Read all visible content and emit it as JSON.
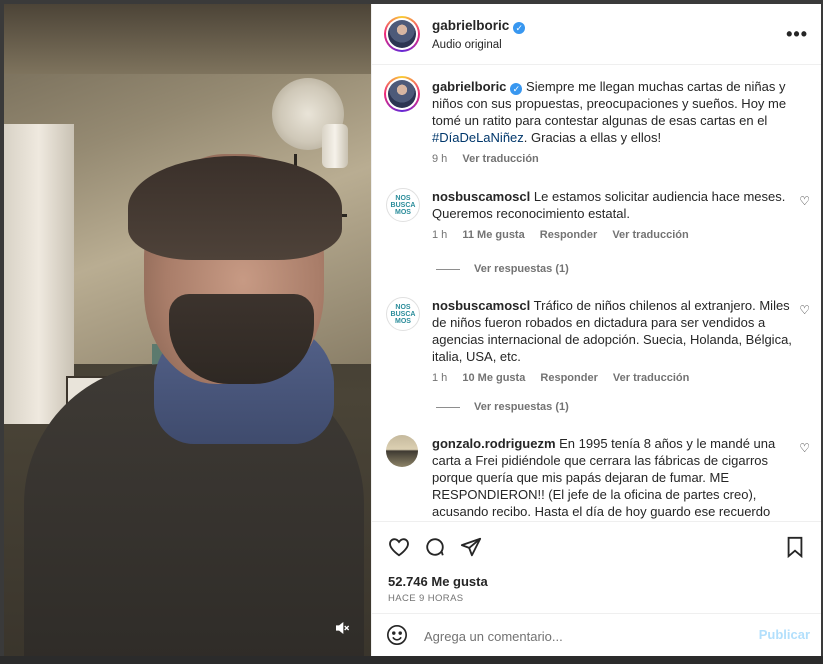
{
  "post": {
    "author": "gabrielboric",
    "audio": "Audio original",
    "caption_prefix": "Siempre me llegan muchas cartas de niñas y niños con sus propuestas, preocupaciones y sueños. Hoy me tomé un ratito para contestar algunas de esas cartas en el ",
    "caption_hashtag": "#DíaDeLaNiñez",
    "caption_suffix": ". Gracias a ellas y ellos!",
    "caption_time": "9 h",
    "caption_translate": "Ver traducción",
    "likes": "52.746 Me gusta",
    "posted": "HACE 9 HORAS"
  },
  "comments": [
    {
      "user": "nosbuscamoscl",
      "avatar_text": "NOS BUSCA MOS",
      "text": "Le estamos solicitar audiencia hace meses. Queremos reconocimiento estatal.",
      "time": "1 h",
      "likes": "11 Me gusta",
      "reply": "Responder",
      "translate": "Ver traducción",
      "replies": "Ver respuestas (1)"
    },
    {
      "user": "nosbuscamoscl",
      "avatar_text": "NOS BUSCA MOS",
      "text": "Tráfico de niños chilenos al extranjero. Miles de niños fueron robados en dictadura para ser vendidos a agencias internacional de adopción. Suecia, Holanda, Bélgica, italia, USA, etc.",
      "time": "1 h",
      "likes": "10 Me gusta",
      "reply": "Responder",
      "translate": "Ver traducción",
      "replies": "Ver respuestas (1)"
    },
    {
      "user": "gonzalo.rodriguezm",
      "text": "En 1995 tenía 8 años y le mandé una carta a Frei pidiéndole que cerrara las fábricas de cigarros porque quería que mis papás dejaran de fumar. ME RESPONDIERON!! (El jefe de la oficina de partes creo), acusando recibo. Hasta el día de hoy guardo ese recuerdo con mucho cariño. Gracias por hacer esto."
    }
  ],
  "composer": {
    "placeholder": "Agrega un comentario...",
    "publish": "Publicar"
  },
  "icons": [
    "more-options-icon",
    "heart-icon",
    "comment-icon",
    "share-icon",
    "bookmark-icon",
    "emoji-icon",
    "mute-icon",
    "verified-icon"
  ]
}
